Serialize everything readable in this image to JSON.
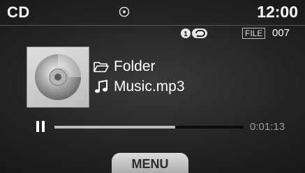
{
  "header": {
    "source": "CD",
    "clock": "12:00",
    "disc_icon": "disc-inserted-icon"
  },
  "indicators": {
    "repeat_icon": "repeat-one-icon",
    "file_badge": "FILE",
    "file_number": "007"
  },
  "now_playing": {
    "album_art_icon": "compact-disc-icon",
    "folder_icon": "folder-icon",
    "folder": "Folder",
    "track_icon": "music-note-icon",
    "track": "Music.mp3"
  },
  "playback": {
    "state_icon": "pause-icon",
    "progress_fraction": 0.64,
    "elapsed": "0:01:13"
  },
  "footer": {
    "menu_label": "MENU"
  }
}
